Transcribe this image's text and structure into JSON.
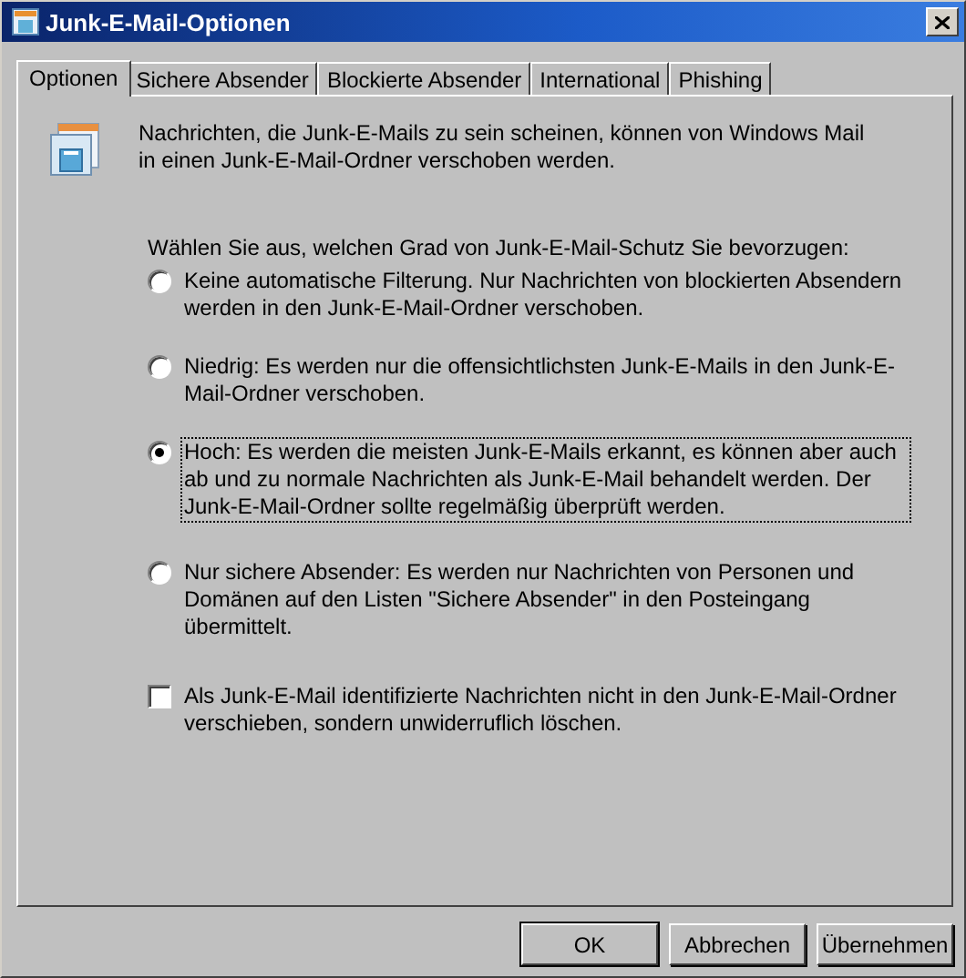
{
  "window": {
    "title": "Junk-E-Mail-Optionen"
  },
  "tabs": [
    {
      "label": "Optionen",
      "selected": true
    },
    {
      "label": "Sichere Absender",
      "selected": false
    },
    {
      "label": "Blockierte Absender",
      "selected": false
    },
    {
      "label": "International",
      "selected": false
    },
    {
      "label": "Phishing",
      "selected": false
    }
  ],
  "intro": "Nachrichten, die Junk-E-Mails zu sein scheinen, können von Windows Mail in einen Junk-E-Mail-Ordner verschoben werden.",
  "prompt": "Wählen Sie aus, welchen Grad von Junk-E-Mail-Schutz Sie bevorzugen:",
  "levels": [
    {
      "label": "Keine automatische Filterung. Nur Nachrichten von blockierten Absendern werden in den Junk-E-Mail-Ordner verschoben.",
      "selected": false,
      "focused": false
    },
    {
      "label": "Niedrig: Es werden nur die offensichtlichsten Junk-E-Mails in den Junk-E-Mail-Ordner verschoben.",
      "selected": false,
      "focused": false
    },
    {
      "label": "Hoch: Es werden die meisten Junk-E-Mails erkannt, es können aber auch ab und zu normale Nachrichten als Junk-E-Mail behandelt werden. Der Junk-E-Mail-Ordner sollte regelmäßig überprüft werden.",
      "selected": true,
      "focused": true
    },
    {
      "label": "Nur sichere Absender: Es werden nur Nachrichten von Personen und Domänen auf den Listen \"Sichere Absender\" in den Posteingang übermittelt.",
      "selected": false,
      "focused": false
    }
  ],
  "delete_option": {
    "label": "Als Junk-E-Mail identifizierte Nachrichten nicht in den Junk-E-Mail-Ordner verschieben, sondern unwiderruflich löschen.",
    "checked": false
  },
  "buttons": [
    "OK",
    "Abbrechen",
    "Übernehmen"
  ]
}
